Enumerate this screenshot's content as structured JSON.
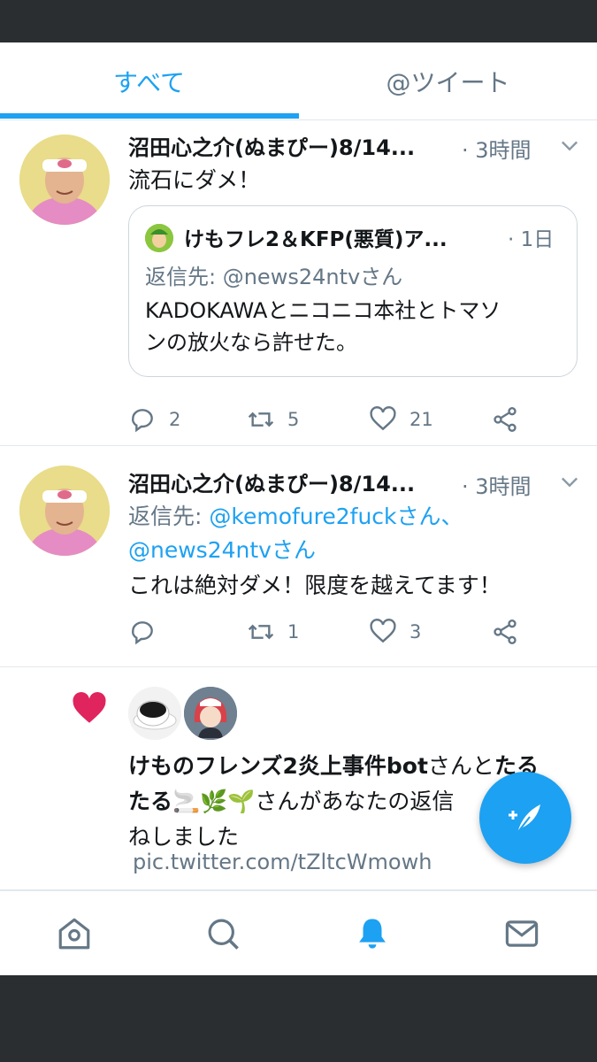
{
  "tabs": {
    "all": "すべて",
    "tweets": "@ツイート"
  },
  "tweets": [
    {
      "name": "沼田心之介(ぬまぴー)8/14...",
      "time": "· 3時間",
      "text": "流石にダメ！",
      "quote": {
        "name": "けもフレ2＆KFP(悪質)ア...",
        "time": "· 1日",
        "reply_to": "返信先: @news24ntvさん",
        "text_line1": "KADOKAWAとニコニコ本社とトマソ",
        "text_line2": "ンの放火なら許せた。"
      },
      "replies": "2",
      "retweets": "5",
      "likes": "21"
    },
    {
      "name": "沼田心之介(ぬまぴー)8/14...",
      "time": "· 3時間",
      "reply_prefix": "返信先: ",
      "reply_user1": "@kemofure2fuckさん、",
      "reply_user2": "@news24ntvさん",
      "text": "これは絶対ダメ！限度を越えてます！",
      "replies": "",
      "retweets": "1",
      "likes": "3"
    }
  ],
  "notification": {
    "bold_name1": "けものフレンズ2炎上事件bot",
    "san1": "さんと",
    "bold_name2_line1": "たる",
    "bold_name2_line2": "たる",
    "emoji": "🚬🌿🌱",
    "rest_line2": "さんがあなたの返信",
    "rest_line3": "ねしました",
    "link": "pic.twitter.com/tZltcWmowh"
  },
  "colors": {
    "accent": "#1da1f2",
    "like": "#e0245e",
    "muted": "#657786"
  },
  "icons": {
    "tab_home": "home-icon",
    "tab_search": "search-icon",
    "tab_notifications": "bell-icon",
    "tab_messages": "mail-icon",
    "fab": "compose-tweet-icon"
  }
}
